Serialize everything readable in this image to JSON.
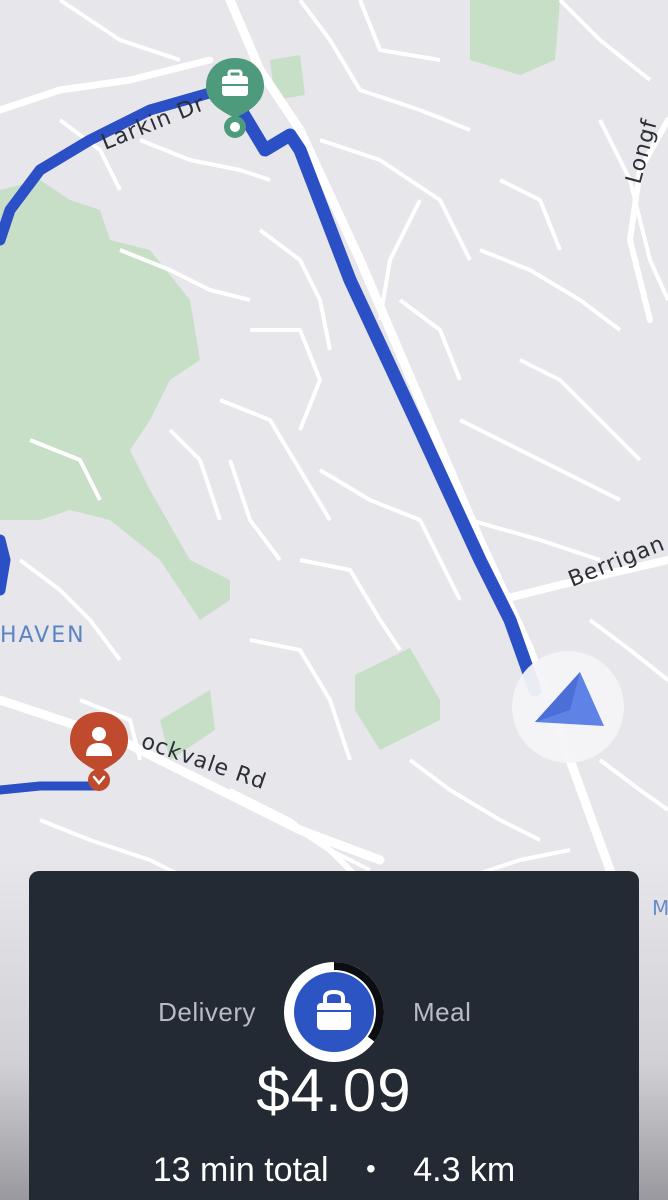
{
  "map": {
    "streets": {
      "larkin": "Larkin Dr",
      "longf": "Longf",
      "berrigan": "Berrigan D",
      "rockvale": "ockvale Rd"
    },
    "area_label": "HAVEN",
    "edge_label": "M",
    "icons": {
      "pickup": "briefcase-icon",
      "dropoff": "person-icon",
      "current_location": "navigation-arrow-icon"
    },
    "colors": {
      "route": "#2b4fc4",
      "pickup_pin": "#4e9a7c",
      "dropoff_pin": "#bf4a2e",
      "park": "#c7dfc7"
    }
  },
  "trip_card": {
    "left_label": "Delivery",
    "right_label": "Meal",
    "badge_icon": "bag-icon",
    "price": "$4.09",
    "duration": "13 min total",
    "separator": "•",
    "distance": "4.3 km",
    "progress": 0.35,
    "colors": {
      "card_bg": "#242a33",
      "badge_blue": "#2c55c3"
    }
  }
}
